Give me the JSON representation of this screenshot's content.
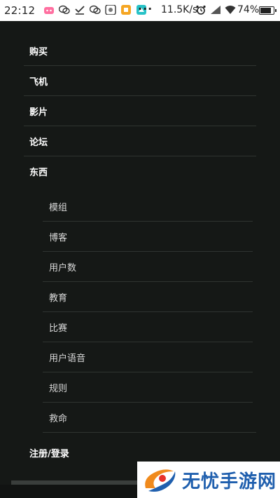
{
  "status_bar": {
    "time": "22:12",
    "dots": "···",
    "speed": "11.5K/s",
    "battery_percent": "74%",
    "icons_left": [
      "bilibili-icon",
      "wechat-icon",
      "download-icon",
      "wechat-icon",
      "app-icon",
      "app-icon",
      "app-icon"
    ],
    "icons_right": [
      "alarm-icon",
      "signal-icon",
      "wifi-icon"
    ]
  },
  "menu": {
    "items": [
      {
        "label": "购买"
      },
      {
        "label": "飞机"
      },
      {
        "label": "影片"
      },
      {
        "label": "论坛"
      },
      {
        "label": "东西"
      }
    ],
    "sub_items": [
      {
        "label": "模组"
      },
      {
        "label": "博客"
      },
      {
        "label": "用户数"
      },
      {
        "label": "教育"
      },
      {
        "label": "比赛"
      },
      {
        "label": "用户语音"
      },
      {
        "label": "规则"
      },
      {
        "label": "救命"
      }
    ],
    "login_label": "注册/登录"
  },
  "watermark": {
    "text": "无忧手游网"
  },
  "colors": {
    "background": "#151816",
    "divider": "#2f3431",
    "top_text": "#ffffff",
    "sub_text": "#d9d9d9",
    "watermark_text": "#1f5fae"
  }
}
